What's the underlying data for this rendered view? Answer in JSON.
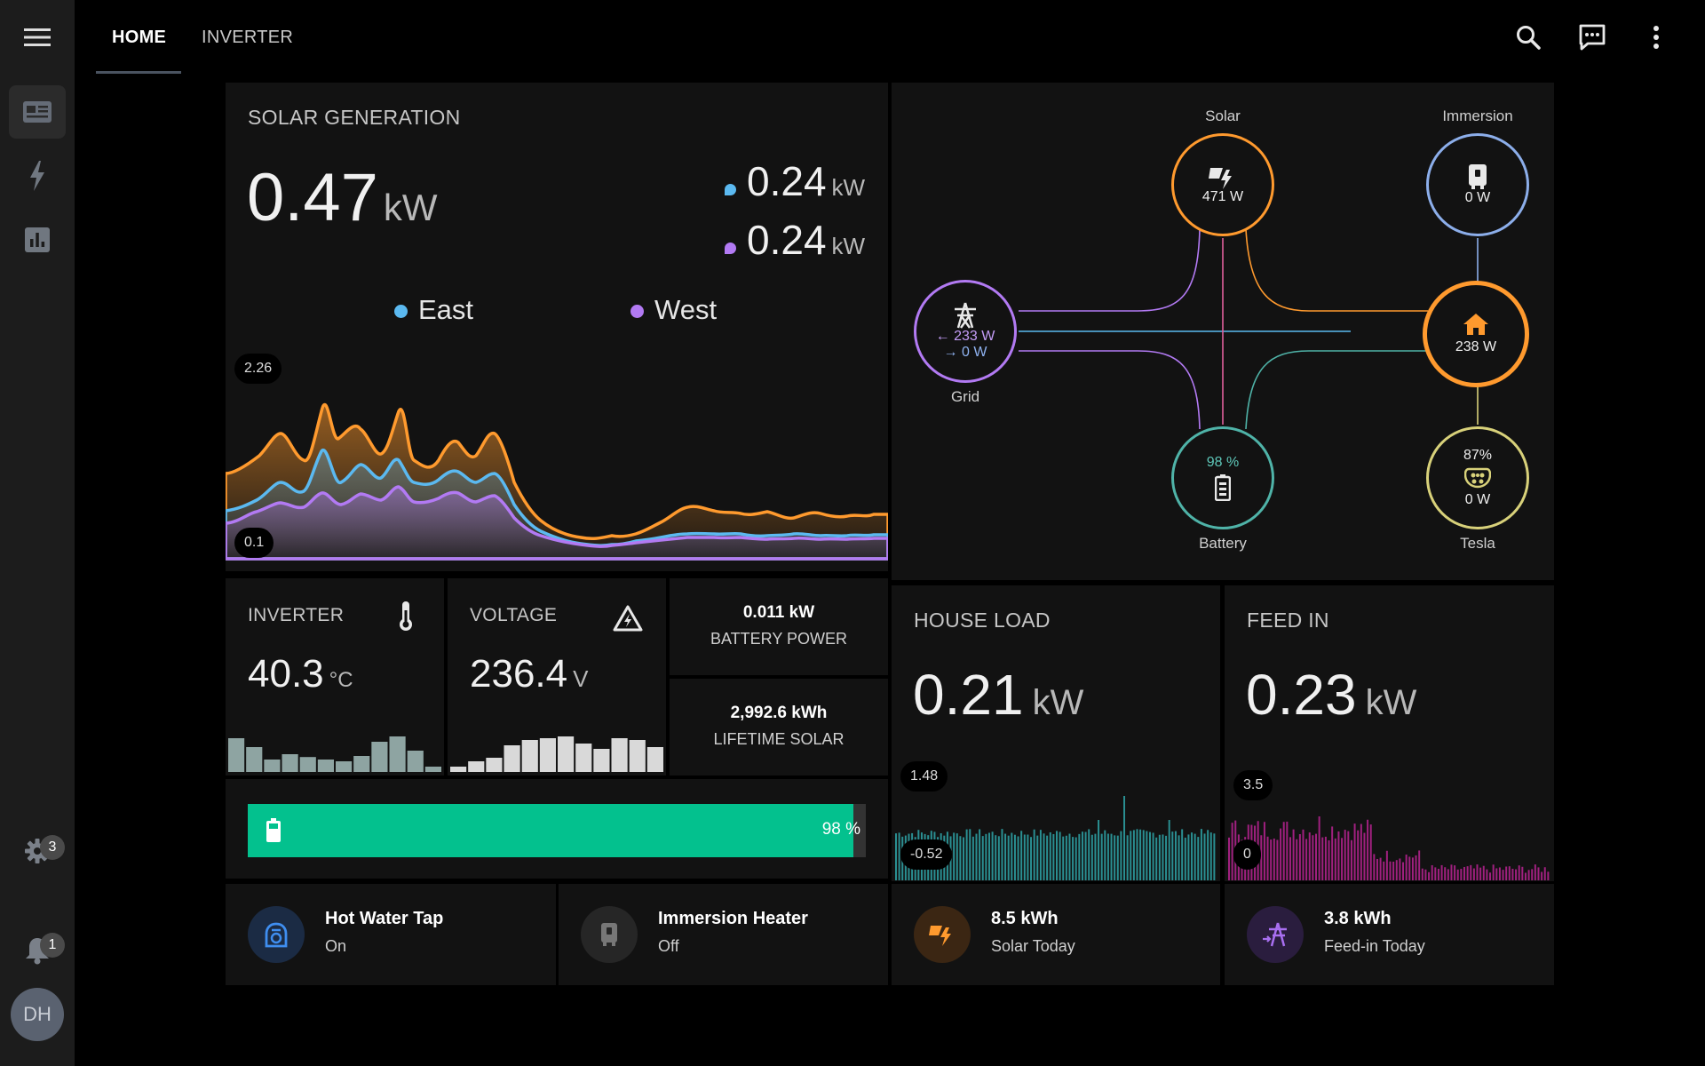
{
  "nav": {
    "tabs": [
      {
        "label": "HOME"
      },
      {
        "label": "INVERTER"
      }
    ],
    "settings_badge": "3",
    "notifications_badge": "1",
    "avatar_initials": "DH"
  },
  "solar": {
    "title": "SOLAR GENERATION",
    "value": "0.47",
    "unit": "kW",
    "east_value": "0.24",
    "west_value": "0.24",
    "sub_unit": "kW",
    "legend_east": "East",
    "legend_west": "West",
    "chart_max_label": "2.26",
    "chart_min_label": "0.1",
    "colors": {
      "east": "#5bb9f0",
      "west": "#b27af3",
      "total": "#ff9a2e"
    }
  },
  "power_flow": {
    "solar": {
      "label": "Solar",
      "value": "471 W"
    },
    "immersion": {
      "label": "Immersion",
      "value": "0 W"
    },
    "grid": {
      "label": "Grid",
      "import": "233 W",
      "export": "0 W"
    },
    "home": {
      "value": "238 W"
    },
    "battery": {
      "label": "Battery",
      "percent": "98 %"
    },
    "tesla": {
      "label": "Tesla",
      "percent": "87%",
      "value": "0 W"
    }
  },
  "inverter": {
    "title": "INVERTER",
    "value": "40.3",
    "unit": "°C",
    "history": [
      0.95,
      0.7,
      0.35,
      0.5,
      0.42,
      0.35,
      0.3,
      0.45,
      0.85,
      1.0,
      0.6,
      0.15
    ]
  },
  "voltage": {
    "title": "VOLTAGE",
    "value": "236.4",
    "unit": "V",
    "history": [
      0.15,
      0.3,
      0.4,
      0.75,
      0.9,
      0.95,
      1.0,
      0.8,
      0.65,
      0.95,
      0.9,
      0.7
    ]
  },
  "battery_power": {
    "value": "0.011 kW",
    "label": "BATTERY POWER"
  },
  "lifetime_solar": {
    "value": "2,992.6 kWh",
    "label": "LIFETIME SOLAR"
  },
  "battery_bar": {
    "label": "98 %",
    "level": 0.98,
    "color": "#03c18e"
  },
  "house_load": {
    "title": "HOUSE LOAD",
    "value": "0.21",
    "unit": "kW",
    "max_label": "1.48",
    "min_label": "-0.52"
  },
  "feed_in": {
    "title": "FEED IN",
    "value": "0.23",
    "unit": "kW",
    "max_label": "3.5",
    "min_label": "0"
  },
  "tiles": {
    "hot_water": {
      "name": "Hot Water Tap",
      "state": "On"
    },
    "immersion": {
      "name": "Immersion Heater",
      "state": "Off"
    },
    "solar_today": {
      "value": "8.5 kWh",
      "label": "Solar Today"
    },
    "feed_in_today": {
      "value": "3.8 kWh",
      "label": "Feed-in Today"
    }
  }
}
